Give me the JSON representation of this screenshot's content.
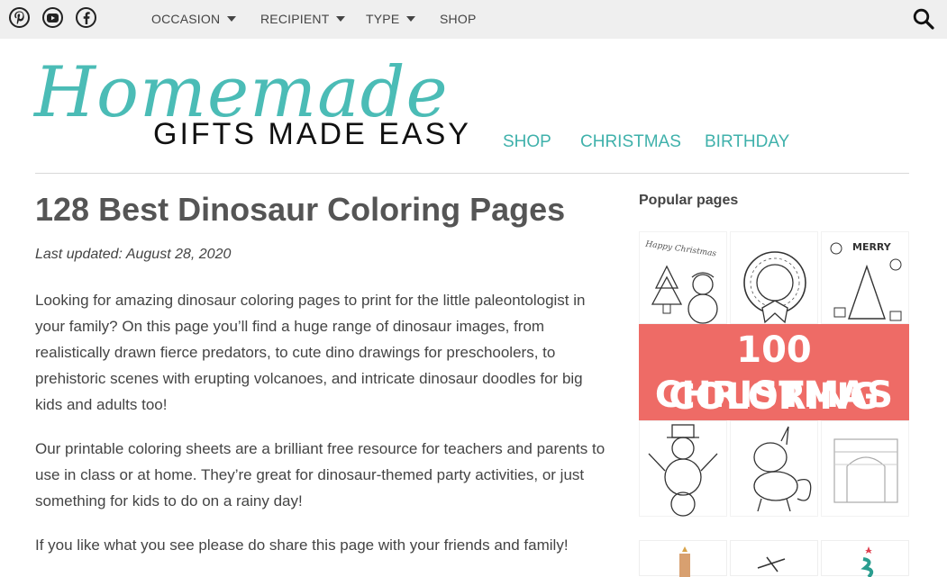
{
  "topbar": {
    "social": [
      {
        "icon": "pinterest-icon"
      },
      {
        "icon": "youtube-icon"
      },
      {
        "icon": "facebook-icon"
      }
    ],
    "nav": [
      {
        "label": "OCCASION",
        "dropdown": true
      },
      {
        "label": "RECIPIENT",
        "dropdown": true
      },
      {
        "label": "TYPE",
        "dropdown": true
      },
      {
        "label": "SHOP",
        "dropdown": false
      }
    ],
    "search_icon": "search-icon"
  },
  "logo": {
    "script": "Homemade",
    "subtitle": "GIFTS MADE EASY",
    "color": "#4bbcb6"
  },
  "main_nav": [
    "SHOP",
    "CHRISTMAS",
    "BIRTHDAY"
  ],
  "article": {
    "title": "128 Best Dinosaur Coloring Pages",
    "updated": "Last updated: August 28, 2020",
    "paragraphs": [
      "Looking for amazing dinosaur coloring pages to print for the little paleontologist in your family? On this page you’ll find a huge range of dinosaur images, from realistically drawn fierce predators, to cute dino drawings for preschoolers, to prehistoric scenes with erupting volcanoes, and intricate dinosaur doodles for big kids and adults too!",
      "Our printable coloring sheets are a brilliant free resource for teachers and parents to use in class or at home. They’re great for dinosaur-themed party activities, or just something for kids to do on a rainy day!",
      "If you like what you see please do share this page with your friends and family!"
    ]
  },
  "sidebar": {
    "title": "Popular pages",
    "card": {
      "banner_line1": "100 CHRISTMAS",
      "banner_line2": "COLORING PAGES",
      "banner_color": "#ee6b66",
      "thumb_labels": [
        "Happy Christmas",
        "MERRY"
      ]
    }
  }
}
